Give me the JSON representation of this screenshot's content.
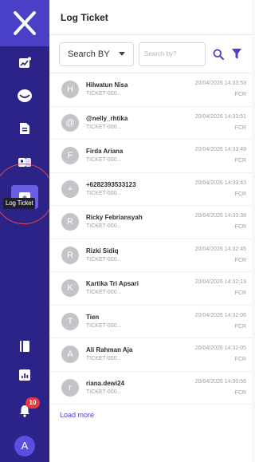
{
  "panel": {
    "title": "Log Ticket"
  },
  "search": {
    "by_label": "Search BY",
    "placeholder": "Search by?",
    "value": ""
  },
  "sidebar": {
    "items": [
      {
        "icon": "analytics-chart-icon"
      },
      {
        "icon": "chat-bubble-icon"
      },
      {
        "icon": "document-icon"
      },
      {
        "icon": "contacts-icon"
      },
      {
        "icon": "log-ticket-icon",
        "active": true,
        "tooltip": "Log Ticket"
      },
      {
        "icon": "book-icon"
      },
      {
        "icon": "report-chart-icon"
      },
      {
        "icon": "notification-bell-icon",
        "badge": "10"
      }
    ],
    "user_initial": "A",
    "accent_color": "#2b2387",
    "active_color": "#6a5fe2"
  },
  "tickets": [
    {
      "initial": "H",
      "name": "Hilwatun Nisa",
      "id": "TICKET-000...",
      "time": "20/04/2026 14:33:53",
      "type": "FCR"
    },
    {
      "initial": "@",
      "name": "@nelly_rhtika",
      "id": "TICKET-000...",
      "time": "20/04/2026 14:33:51",
      "type": "FCR"
    },
    {
      "initial": "F",
      "name": "Firda Ariana",
      "id": "TICKET-000...",
      "time": "20/04/2026 14:33:49",
      "type": "FCR"
    },
    {
      "initial": "+",
      "name": "+6282393533123",
      "id": "TICKET-000...",
      "time": "20/04/2026 14:33:43",
      "type": "FCR"
    },
    {
      "initial": "R",
      "name": "Ricky Febriansyah",
      "id": "TICKET-000...",
      "time": "20/04/2026 14:33:38",
      "type": "FCR"
    },
    {
      "initial": "R",
      "name": "Rizki Sidiq",
      "id": "TICKET-000...",
      "time": "20/04/2026 14:32:45",
      "type": "FCR"
    },
    {
      "initial": "K",
      "name": "Kartika Tri Apsari",
      "id": "TICKET-000...",
      "time": "20/04/2026 14:32:19",
      "type": "FCR"
    },
    {
      "initial": "T",
      "name": "Tien",
      "id": "TICKET-000...",
      "time": "20/04/2026 14:32:06",
      "type": "FCR"
    },
    {
      "initial": "A",
      "name": "Ali Rahman Aja",
      "id": "TICKET-000...",
      "time": "20/04/2026 14:32:05",
      "type": "FCR"
    },
    {
      "initial": "r",
      "name": "riana.dewi24",
      "id": "TICKET-000...",
      "time": "20/04/2026 14:30:56",
      "type": "FCR"
    }
  ],
  "load_more_label": "Load more"
}
